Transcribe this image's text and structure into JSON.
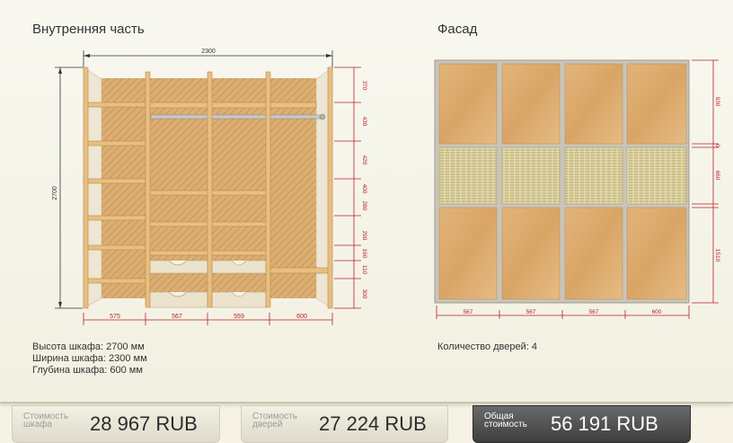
{
  "interior": {
    "title": "Внутренняя часть",
    "overall_width": "2300",
    "overall_height": "2700",
    "bottom_dims": [
      "575",
      "567",
      "559",
      "600"
    ],
    "right_dims": [
      "370",
      "430",
      "420",
      "400",
      "280",
      "290",
      "160",
      "110",
      "300"
    ],
    "specs": [
      "Высота шкафа: 2700 мм",
      "Ширина шкафа: 2300 мм",
      "Глубина шкафа: 600 мм"
    ]
  },
  "facade": {
    "title": "Фасад",
    "bottom_dims": [
      "567",
      "567",
      "567",
      "600"
    ],
    "right_dims": [
      "930",
      "0",
      "660",
      "1510"
    ],
    "doors_info": "Количество дверей: 4"
  },
  "costs": {
    "cabinet": {
      "label_1": "Стоимость",
      "label_2": "шкафа",
      "value": "28 967  RUB"
    },
    "doors": {
      "label_1": "Стоимость",
      "label_2": "дверей",
      "value": "27 224  RUB"
    },
    "total": {
      "label_1": "Общая",
      "label_2": "стоимость",
      "value": "56 191  RUB"
    }
  },
  "colors": {
    "wood": "#dcae73",
    "dimension": "#b8202a",
    "rattan": "#d8cd9a",
    "total_bg": "#4a4a4a"
  }
}
